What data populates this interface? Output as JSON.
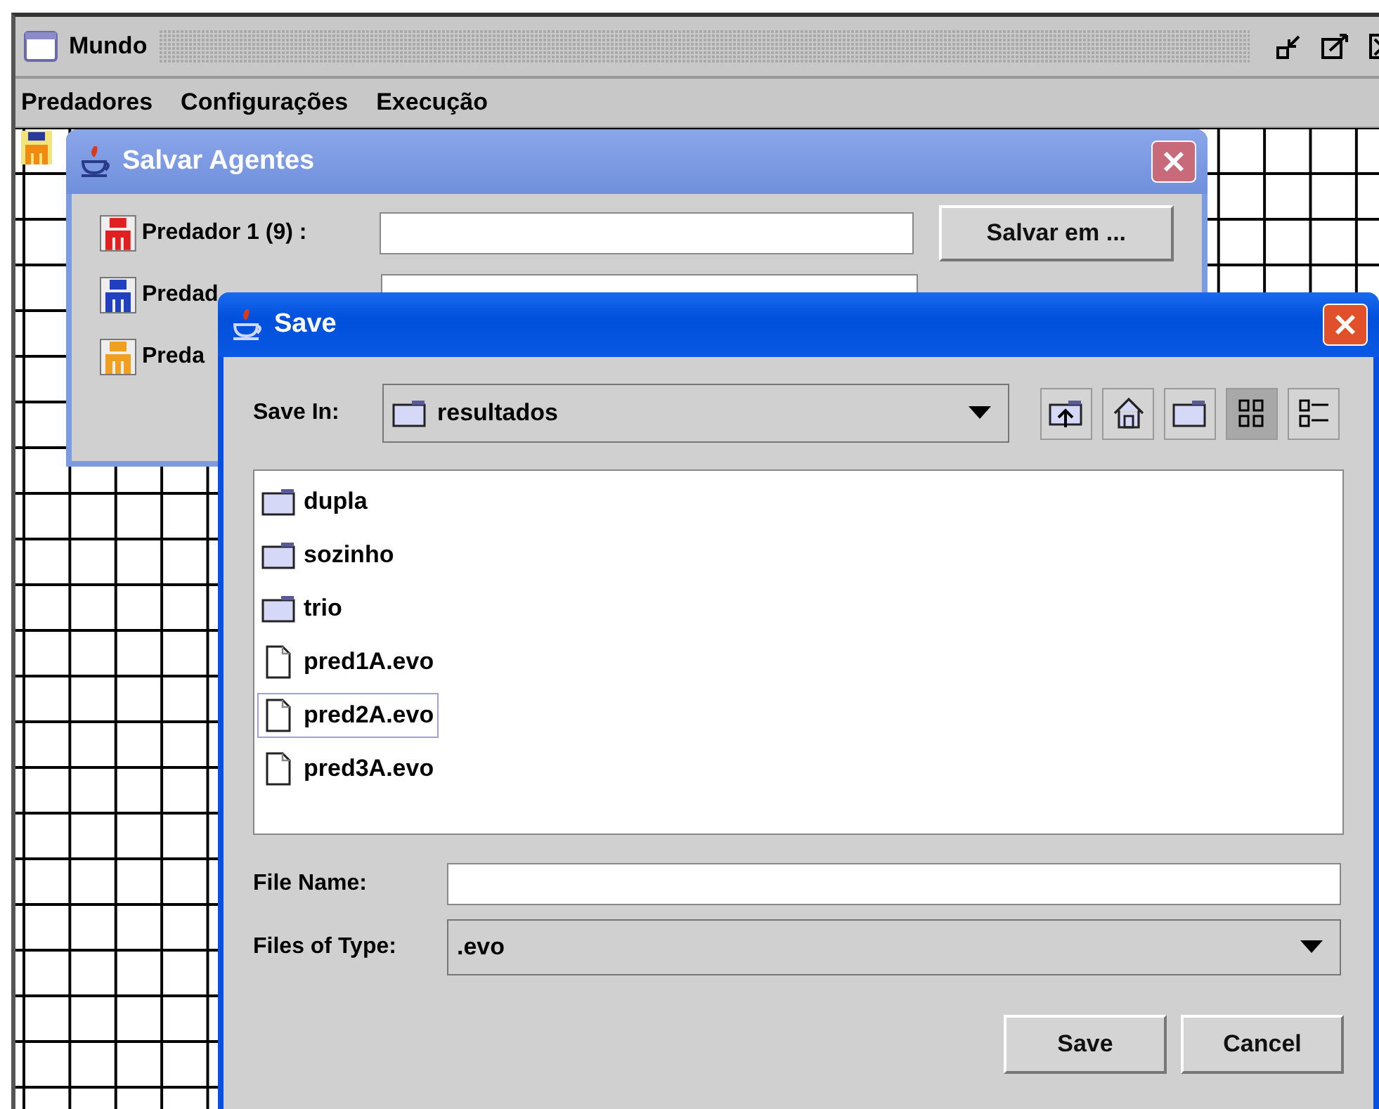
{
  "window": {
    "title": "Mundo"
  },
  "menu": [
    {
      "label": "Predadores"
    },
    {
      "label": "Configurações"
    },
    {
      "label": "Execução"
    }
  ],
  "agents_dialog": {
    "title": "Salvar Agentes",
    "rows": [
      {
        "label": "Predador 1 (9) :",
        "color": "#e02020"
      },
      {
        "label": "Predad",
        "color": "#2040c0"
      },
      {
        "label": "Preda",
        "color": "#f0a020"
      }
    ],
    "button": "Salvar em ..."
  },
  "save_dialog": {
    "title": "Save",
    "save_in_label": "Save In:",
    "folder": "resultados",
    "toolbar": [
      {
        "kind": "up",
        "selected": false
      },
      {
        "kind": "home",
        "selected": false
      },
      {
        "kind": "new-folder",
        "selected": false
      },
      {
        "kind": "list",
        "selected": true
      },
      {
        "kind": "details",
        "selected": false
      }
    ],
    "files": [
      {
        "name": "dupla",
        "kind": "folder",
        "selected": false
      },
      {
        "name": "sozinho",
        "kind": "folder",
        "selected": false
      },
      {
        "name": "trio",
        "kind": "folder",
        "selected": false
      },
      {
        "name": "pred1A.evo",
        "kind": "file",
        "selected": false
      },
      {
        "name": "pred2A.evo",
        "kind": "file",
        "selected": true
      },
      {
        "name": "pred3A.evo",
        "kind": "file",
        "selected": false
      }
    ],
    "file_name_label": "File Name:",
    "file_type_label": "Files of Type:",
    "file_type": ".evo",
    "buttons": [
      "Save",
      "Cancel"
    ]
  }
}
